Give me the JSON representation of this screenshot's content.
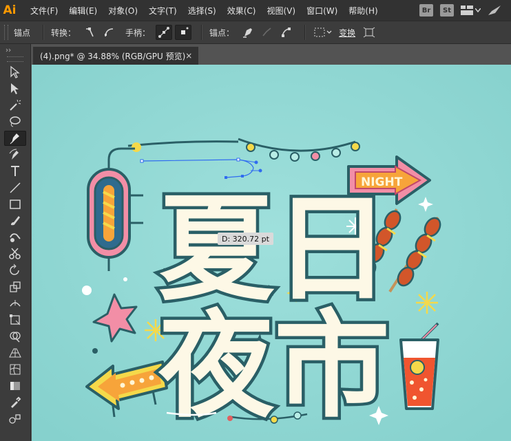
{
  "app": {
    "logo_text": "Ai",
    "menu": [
      "文件(F)",
      "编辑(E)",
      "对象(O)",
      "文字(T)",
      "选择(S)",
      "效果(C)",
      "视图(V)",
      "窗口(W)",
      "帮助(H)"
    ],
    "right_badges": [
      "Br",
      "St"
    ]
  },
  "control_bar": {
    "panel_title": "锚点",
    "convert_label": "转换：",
    "handles_label": "手柄：",
    "anchors_label": "锚点：",
    "transform_label": "变换"
  },
  "document": {
    "tab_title": "(4).png* @ 34.88% (RGB/GPU 预览)",
    "close_glyph": "×"
  },
  "tools": [
    "selection-tool",
    "direct-selection-tool",
    "magic-wand-tool",
    "lasso-tool",
    "pen-tool",
    "curvature-tool",
    "type-tool",
    "line-segment-tool",
    "rectangle-tool",
    "paintbrush-tool",
    "shaper-tool",
    "scissors-tool",
    "rotate-tool",
    "scale-tool",
    "width-tool",
    "free-transform-tool",
    "shape-builder-tool",
    "perspective-grid-tool",
    "mesh-tool",
    "gradient-tool",
    "eyedropper-tool",
    "blend-tool"
  ],
  "active_tool": "pen-tool",
  "artwork": {
    "title_line1": "夏日",
    "title_line2": "夜市",
    "sign_text": "NIGHT"
  },
  "tooltip": {
    "text": "D: 320.72 pt"
  },
  "colors": {
    "menubar": "#323232",
    "control_bar": "#3c3c3c",
    "canvas_bg": "#8fd7d3",
    "accent_ai": "#ff9a00",
    "text_fill": "#fdf8e6",
    "outline": "#2a5f66",
    "pink": "#f28ea6",
    "orange": "#f7a43a",
    "yellow": "#f5d94a",
    "path_blue": "#2f6bf0"
  }
}
